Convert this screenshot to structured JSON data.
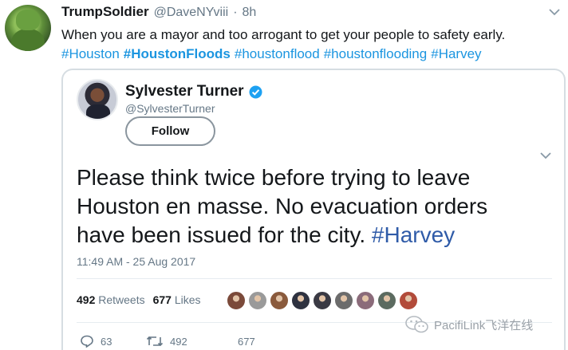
{
  "outer_tweet": {
    "display_name": "TrumpSoldier",
    "handle": "@DaveNYviii",
    "separator": "·",
    "time": "8h",
    "text": "When you are a mayor and too arrogant to get your people to safety early.",
    "hashtags": [
      {
        "text": "#Houston",
        "bold": false
      },
      {
        "text": "#HoustonFloods",
        "bold": true
      },
      {
        "text": "#houstonflood",
        "bold": false
      },
      {
        "text": "#houstonflooding",
        "bold": false
      },
      {
        "text": "#Harvey",
        "bold": false
      }
    ],
    "link_color": "#1b95e0"
  },
  "quoted_tweet": {
    "display_name": "Sylvester Turner",
    "handle": "@SylvesterTurner",
    "follow_label": "Follow",
    "text_lines": [
      "Please think twice before trying to leave",
      "Houston en masse. No evacuation orders",
      "have been issued for the city. "
    ],
    "hashtag": "#Harvey",
    "timestamp": "11:49 AM - 25 Aug 2017",
    "retweets_count": "492",
    "retweets_label": "Retweets",
    "likes_count": "677",
    "likes_label": "Likes",
    "liker_avatar_colors": [
      "#7b4a3a",
      "#9a9a9a",
      "#8a5a3c",
      "#2e3240",
      "#3a3a44",
      "#6c6c6c",
      "#8b6b7a",
      "#5c6b60",
      "#b24b3a"
    ],
    "actions": {
      "reply_count": "63",
      "retweet_count": "492",
      "like_count": "677"
    },
    "verified_color": "#1da1f2",
    "hashtag_color": "#2f5ba8"
  },
  "watermark": {
    "text": "PacifiLink飞洋在线"
  }
}
